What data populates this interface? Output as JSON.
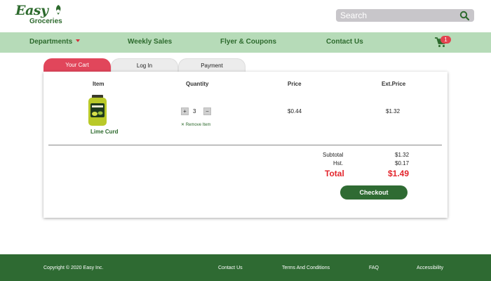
{
  "brand": {
    "logo_word": "Easy",
    "logo_sub": "Groceries"
  },
  "search": {
    "placeholder": "Search",
    "value": ""
  },
  "nav": {
    "items": [
      "Departments",
      "Weekly Sales",
      "Flyer & Coupons",
      "Contact Us"
    ],
    "cart_count": "1"
  },
  "tabs": [
    "Your Cart",
    "Log In",
    "Payment"
  ],
  "cart": {
    "headers": {
      "item": "Item",
      "quantity": "Quantity",
      "price": "Price",
      "ext_price": "Ext.Price"
    },
    "rows": [
      {
        "name": "Lime Curd",
        "quantity": "3",
        "price": "$0.44",
        "ext_price": "$1.32",
        "remove_label": "Remove Item"
      }
    ],
    "qty_minus": "−",
    "qty_plus": "+"
  },
  "totals": {
    "subtotal_label": "Subtotal",
    "subtotal": "$1.32",
    "tax_label": "Hst.",
    "tax": "$0.17",
    "total_label": "Total",
    "total": "$1.49"
  },
  "checkout_label": "Checkout",
  "footer": {
    "copyright": "Copyright © 2020 Easy Inc.",
    "links": [
      "Contact Us",
      "Terms And Conditions",
      "FAQ",
      "Accessibility"
    ]
  },
  "colors": {
    "brand_green": "#2d6a2d",
    "nav_bg": "#b6dbb8",
    "accent_red": "#e1465b",
    "total_red": "#e3252c",
    "footer_bg": "#2e6a32"
  }
}
